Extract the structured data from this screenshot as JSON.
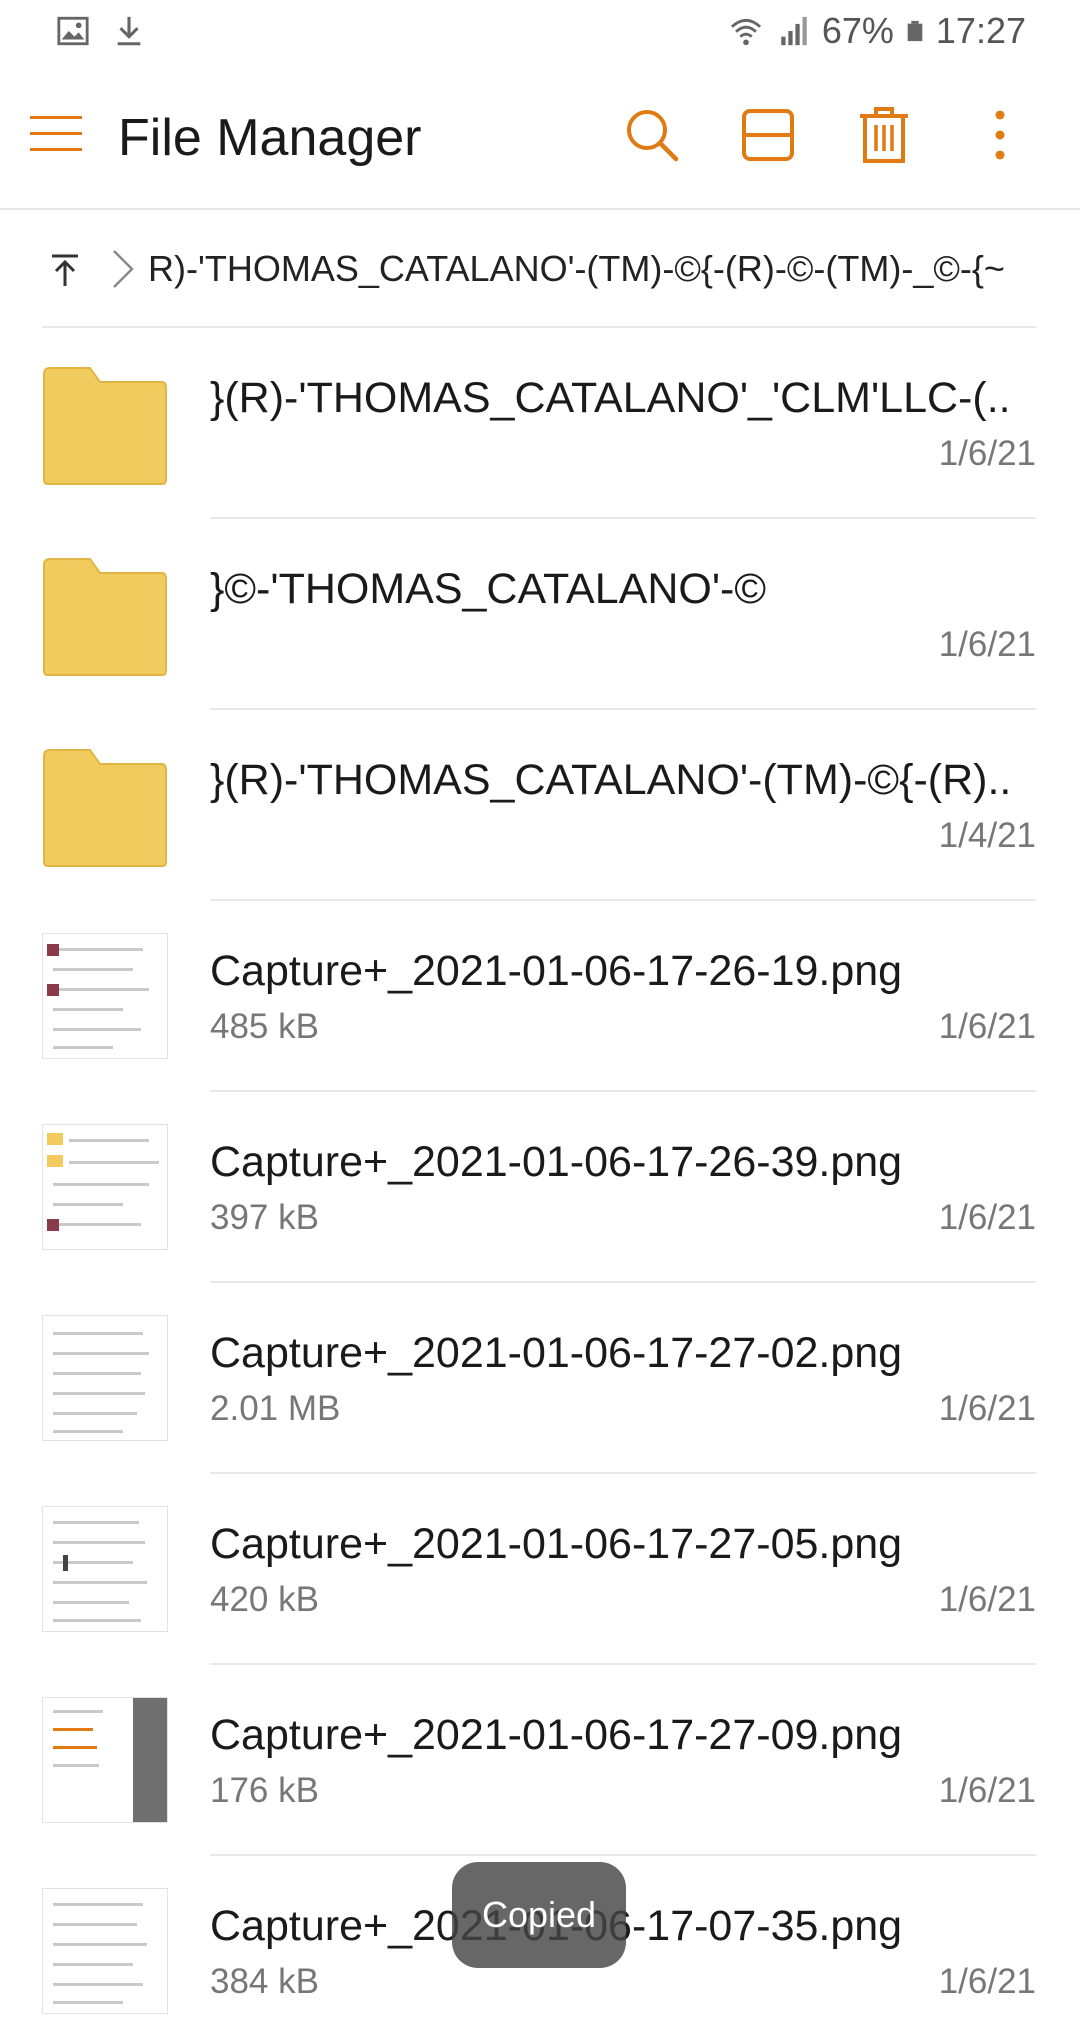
{
  "status_bar": {
    "left_icons": [
      "gallery-icon",
      "download-icon"
    ],
    "battery": "67%",
    "time": "17:27"
  },
  "app_bar": {
    "title": "File Manager",
    "actions": [
      "search-icon",
      "split-view-icon",
      "trash-icon",
      "more-vert-icon"
    ],
    "accent_color": "#e07a12"
  },
  "breadcrumb": {
    "path": "R)-'THOMAS_CATALANO'-(TM)-©{-(R)-©-(TM)-_©-{~"
  },
  "files": [
    {
      "type": "folder",
      "name": "}(R)-'THOMAS_CATALANO'_'CLM'LLC-(..",
      "size": "",
      "date": "1/6/21"
    },
    {
      "type": "folder",
      "name": "}©-'THOMAS_CATALANO'-©",
      "size": "",
      "date": "1/6/21"
    },
    {
      "type": "folder",
      "name": "}(R)-'THOMAS_CATALANO'-(TM)-©{-(R)..",
      "size": "",
      "date": "1/4/21"
    },
    {
      "type": "image",
      "name": "Capture+_2021-01-06-17-26-19.png",
      "size": "485 kB",
      "date": "1/6/21"
    },
    {
      "type": "image",
      "name": "Capture+_2021-01-06-17-26-39.png",
      "size": "397 kB",
      "date": "1/6/21"
    },
    {
      "type": "image",
      "name": "Capture+_2021-01-06-17-27-02.png",
      "size": "2.01 MB",
      "date": "1/6/21"
    },
    {
      "type": "image",
      "name": "Capture+_2021-01-06-17-27-05.png",
      "size": "420 kB",
      "date": "1/6/21"
    },
    {
      "type": "image",
      "name": "Capture+_2021-01-06-17-27-09.png",
      "size": "176 kB",
      "date": "1/6/21"
    },
    {
      "type": "image",
      "name": "Capture+_2021-01-06-17-07-35.png",
      "size": "384 kB",
      "date": "1/6/21"
    }
  ],
  "toast": {
    "text": "Copied"
  },
  "colors": {
    "folder": "#f2cb5f",
    "folder_edge": "#e0b543",
    "accent": "#e07a12"
  }
}
